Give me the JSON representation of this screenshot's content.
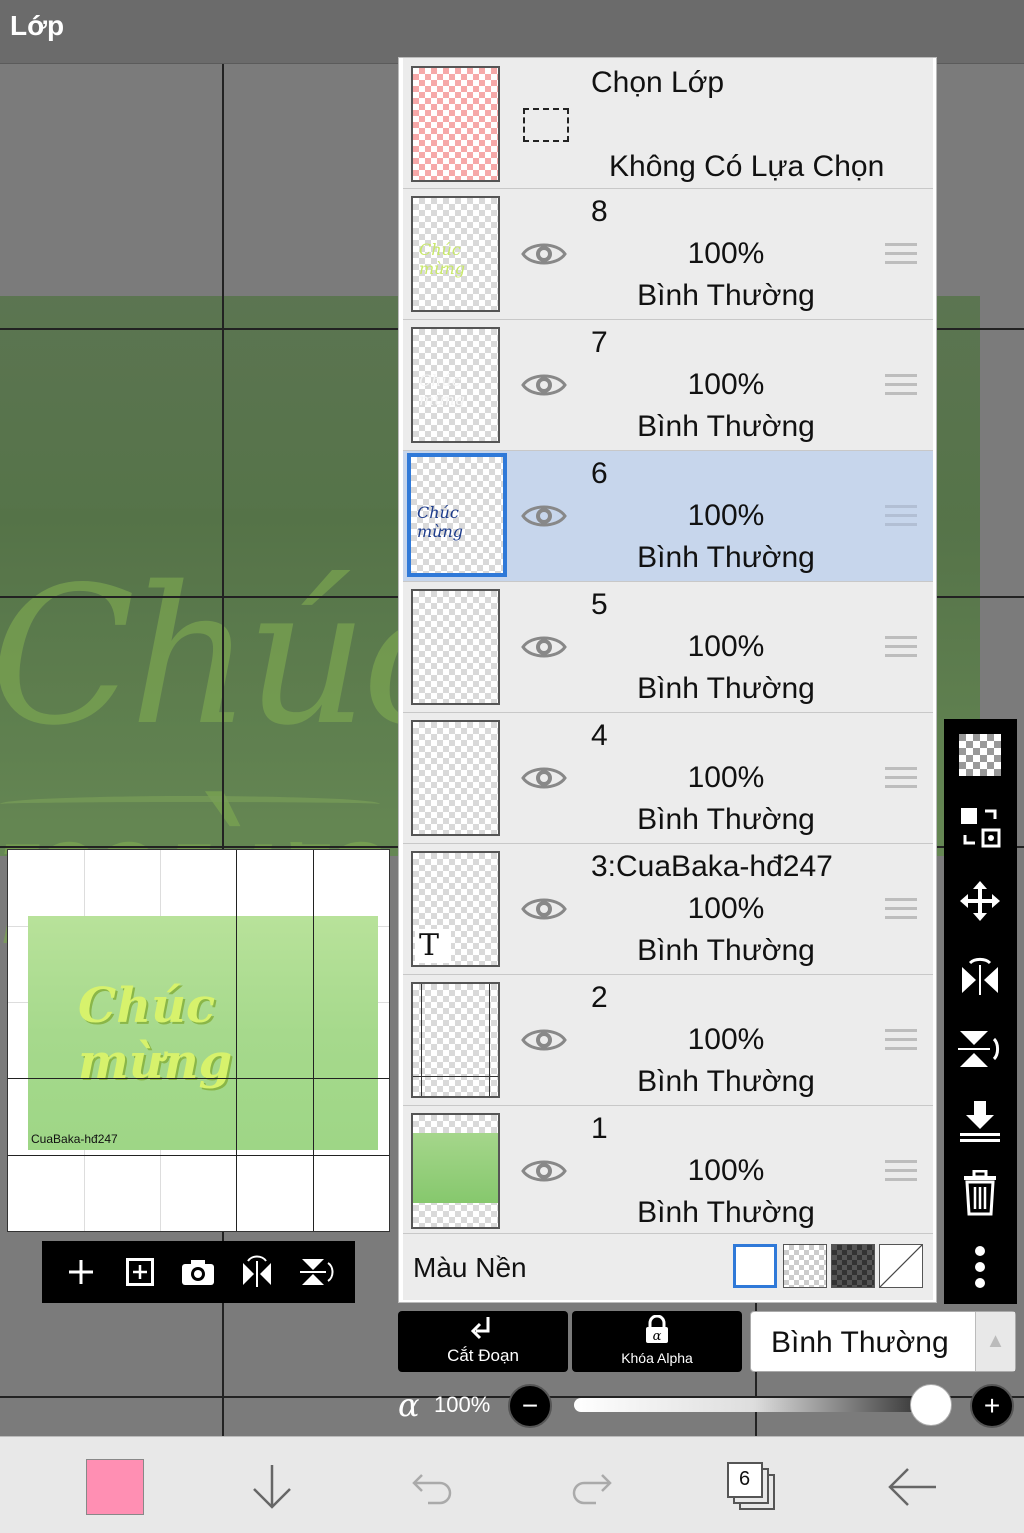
{
  "header": {
    "title": "Lớp"
  },
  "preview": {
    "signature": "CuaBaka-hđ247",
    "art_text": "Chúc mừng"
  },
  "layers": {
    "selection": {
      "title": "Chọn Lớp",
      "subtitle": "Không Có Lựa Chọn"
    },
    "items": [
      {
        "name": "8",
        "opacity": "100%",
        "mode": "Bình Thường"
      },
      {
        "name": "7",
        "opacity": "100%",
        "mode": "Bình Thường"
      },
      {
        "name": "6",
        "opacity": "100%",
        "mode": "Bình Thường",
        "selected": true
      },
      {
        "name": "5",
        "opacity": "100%",
        "mode": "Bình Thường"
      },
      {
        "name": "4",
        "opacity": "100%",
        "mode": "Bình Thường"
      },
      {
        "name": "3:CuaBaka-hđ247",
        "opacity": "100%",
        "mode": "Bình Thường"
      },
      {
        "name": "2",
        "opacity": "100%",
        "mode": "Bình Thường"
      },
      {
        "name": "1",
        "opacity": "100%",
        "mode": "Bình Thường"
      }
    ],
    "background": {
      "label": "Màu Nền"
    }
  },
  "controls": {
    "clip_label": "Cắt Đoạn",
    "alpha_lock_label": "Khóa Alpha",
    "blend_mode": "Bình Thường",
    "alpha_symbol": "α",
    "alpha_value": "100%",
    "alpha_fraction": 1.0
  },
  "bottom_nav": {
    "layer_count": "6",
    "primary_color": "#ff8fb3"
  },
  "colors": {
    "selected_row": "#c7d6ec",
    "selected_border": "#2f79d8"
  }
}
